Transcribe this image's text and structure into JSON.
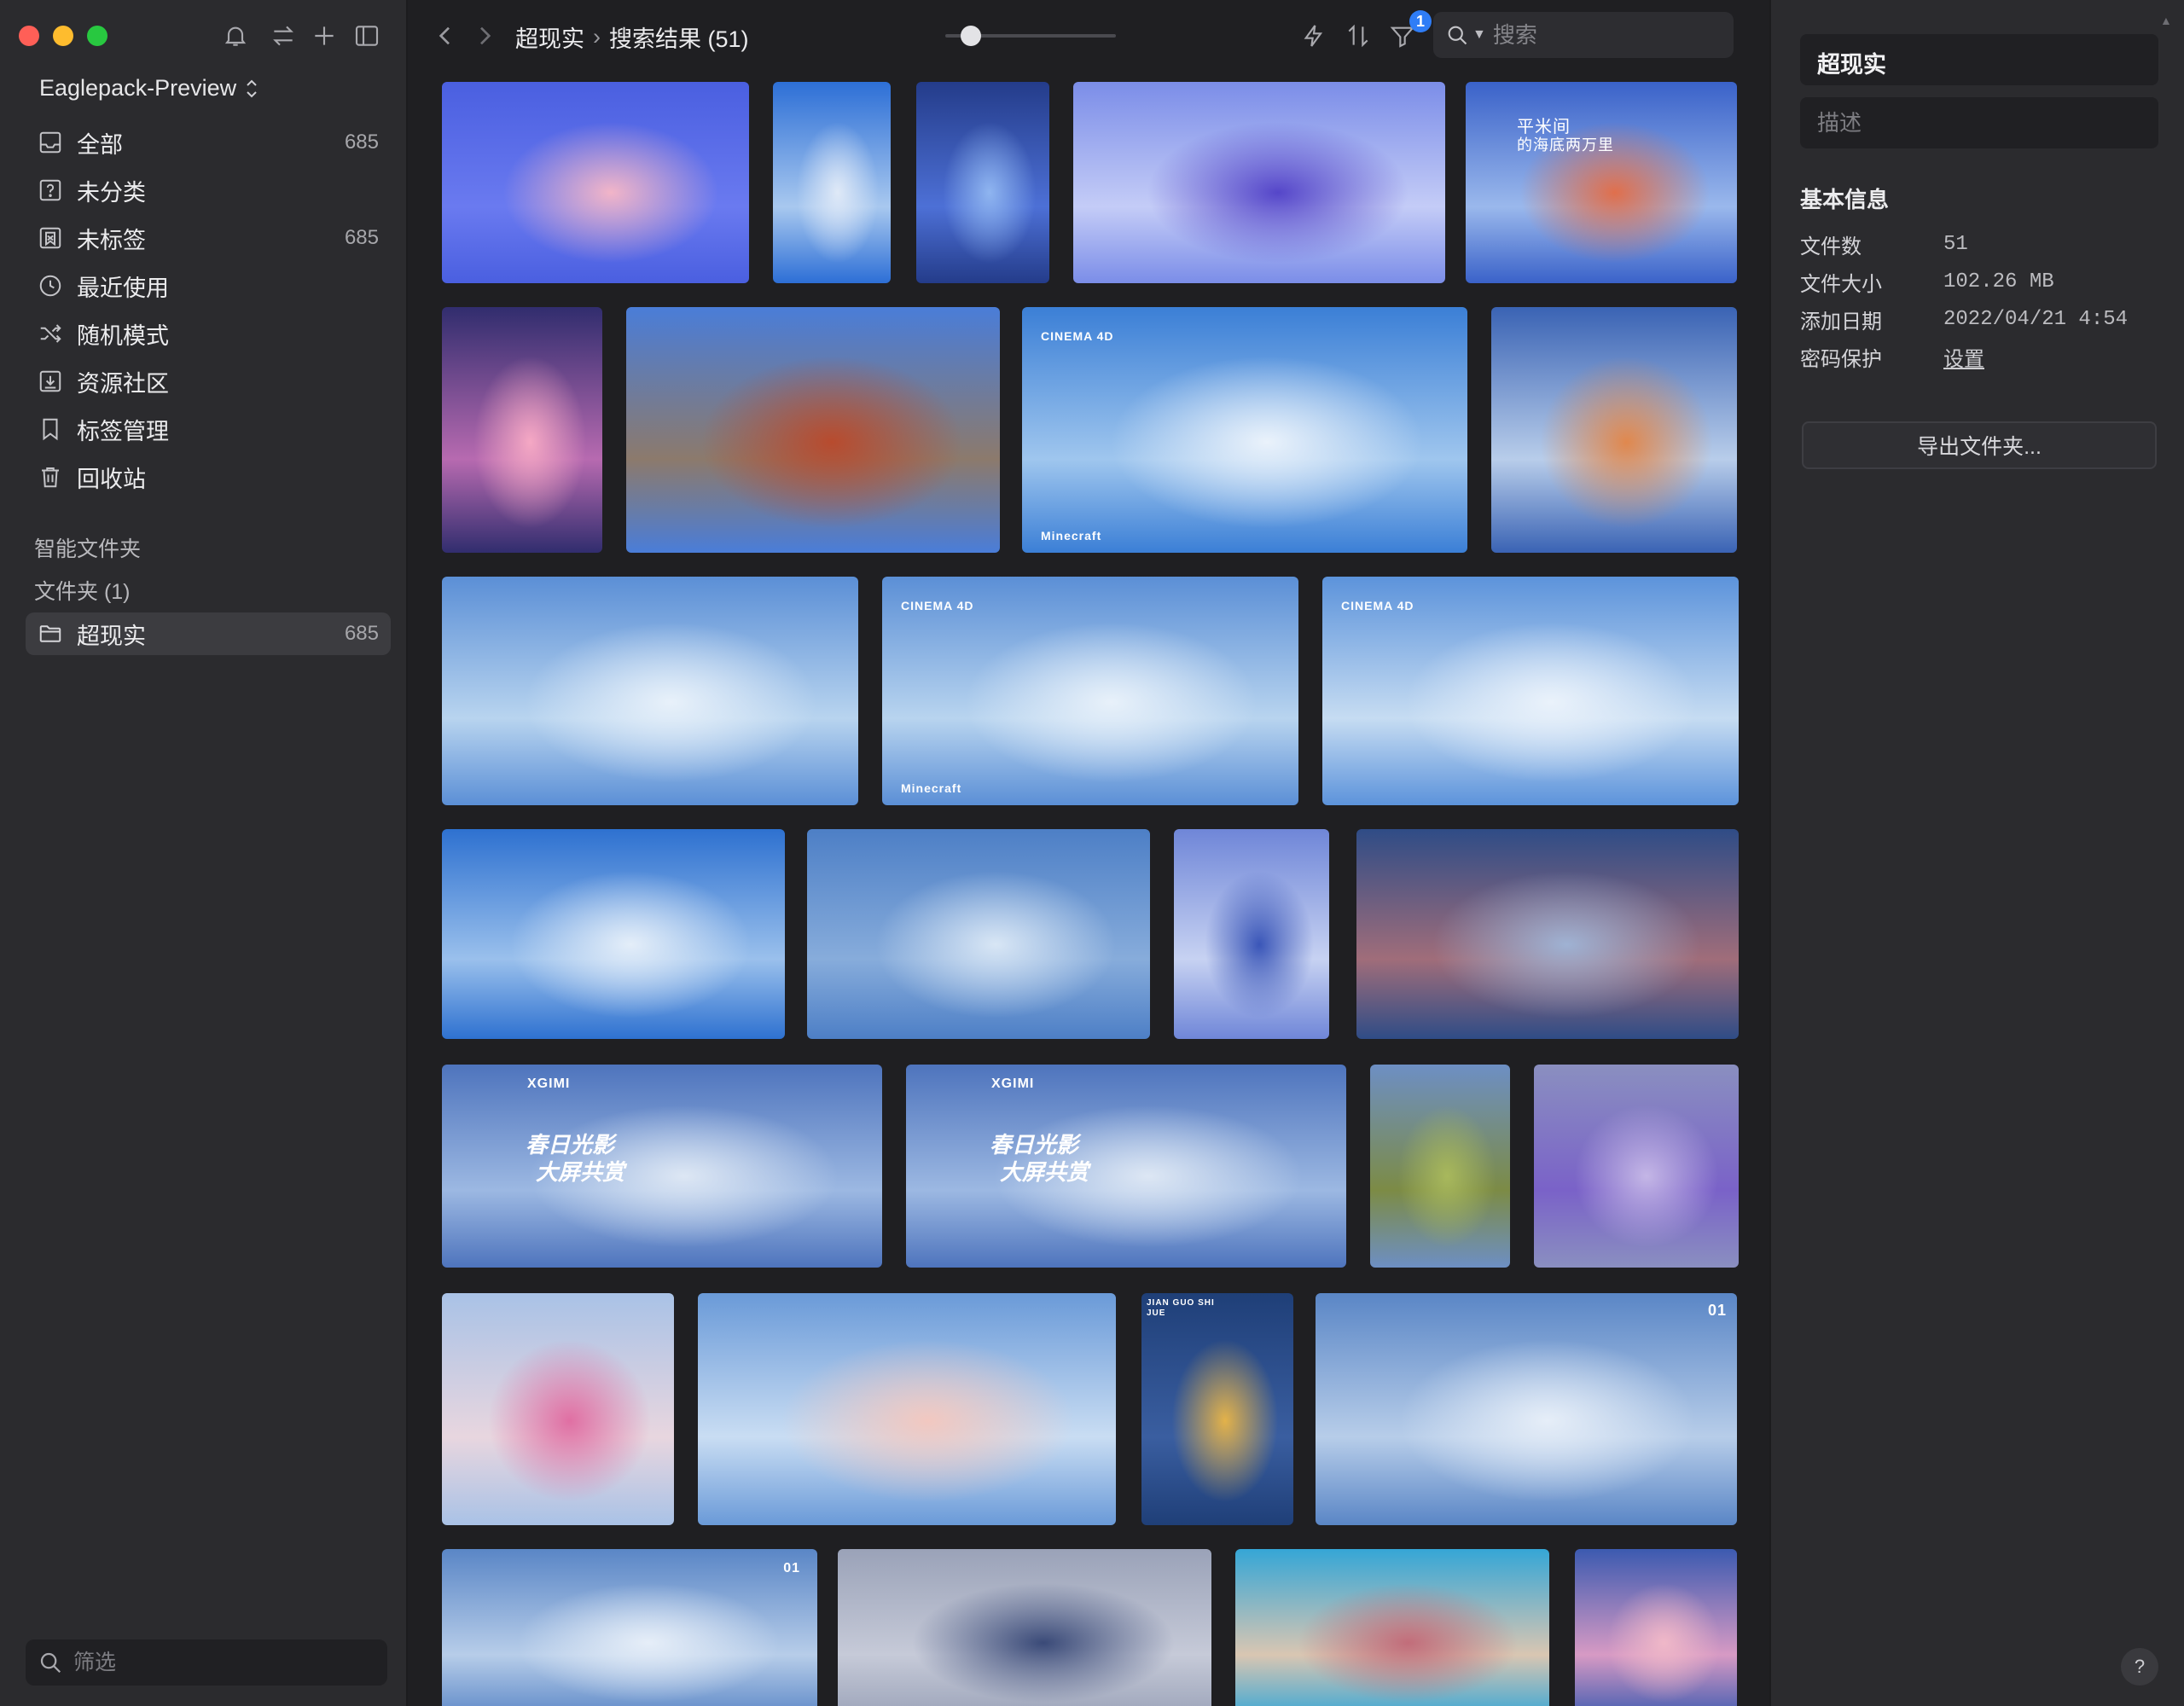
{
  "sidebar": {
    "library_name": "Eaglepack-Preview",
    "nav": [
      {
        "label": "全部",
        "count": "685",
        "icon": "inbox-icon"
      },
      {
        "label": "未分类",
        "count": "",
        "icon": "question-box-icon"
      },
      {
        "label": "未标签",
        "count": "685",
        "icon": "untagged-icon"
      },
      {
        "label": "最近使用",
        "count": "",
        "icon": "clock-icon"
      },
      {
        "label": "随机模式",
        "count": "",
        "icon": "shuffle-icon"
      },
      {
        "label": "资源社区",
        "count": "",
        "icon": "download-box-icon"
      },
      {
        "label": "标签管理",
        "count": "",
        "icon": "bookmark-icon"
      },
      {
        "label": "回收站",
        "count": "",
        "icon": "trash-icon"
      }
    ],
    "smart_folders_label": "智能文件夹",
    "folders_label": "文件夹 (1)",
    "folder": {
      "label": "超现实",
      "count": "685"
    },
    "filter_placeholder": "筛选"
  },
  "toolbar": {
    "breadcrumb_folder": "超现实",
    "breadcrumb_separator": "›",
    "breadcrumb_result": "搜索结果 (51)",
    "zoom_level": 0.15,
    "filter_badge": "1",
    "search_placeholder": "搜索"
  },
  "grid": {
    "thumbs": [
      {
        "palette": [
          "#4a5fe0",
          "#6a7af0",
          "#f2b5c8"
        ]
      },
      {
        "palette": [
          "#2d6fd6",
          "#a8c8ef",
          "#dfe9f7"
        ]
      },
      {
        "palette": [
          "#243c8a",
          "#4d70d6",
          "#8fb5f0"
        ]
      },
      {
        "palette": [
          "#7b8de8",
          "#c4ccf7",
          "#5546c9"
        ]
      },
      {
        "palette": [
          "#3a62c9",
          "#9ab8ec",
          "#e06f4c"
        ]
      },
      {
        "palette": [
          "#312d6e",
          "#b76ab0",
          "#f5a8c4"
        ]
      },
      {
        "palette": [
          "#4a7dd8",
          "#8c7a6c",
          "#b84b2e"
        ]
      },
      {
        "palette": [
          "#3b7fd6",
          "#9fc6ee",
          "#eaf2fb"
        ]
      },
      {
        "palette": [
          "#3a63b4",
          "#b8cdea",
          "#e0884e"
        ]
      },
      {
        "palette": [
          "#5b8fd6",
          "#b8d4ef",
          "#e8f1fa"
        ]
      },
      {
        "palette": [
          "#5b8fd6",
          "#b8d4ef",
          "#e8f1fa"
        ]
      },
      {
        "palette": [
          "#5c93db",
          "#c6dcf2",
          "#eaf2fb"
        ]
      },
      {
        "palette": [
          "#2e71d0",
          "#9ac0ec",
          "#e4eef9"
        ]
      },
      {
        "palette": [
          "#4d7fc6",
          "#87acdb",
          "#d8e6f5"
        ]
      },
      {
        "palette": [
          "#6f86d8",
          "#c7d2f2",
          "#3a56b8"
        ]
      },
      {
        "palette": [
          "#2f4c86",
          "#a06d7a",
          "#9fb2d3"
        ]
      },
      {
        "palette": [
          "#4e74bd",
          "#9cb8e2",
          "#dde7f4"
        ]
      },
      {
        "palette": [
          "#4e74bd",
          "#9cb8e2",
          "#dde7f4"
        ]
      },
      {
        "palette": [
          "#6d8fc4",
          "#7c8b45",
          "#a8b85c"
        ]
      },
      {
        "palette": [
          "#8a8fc0",
          "#7a62c8",
          "#c4b6e6"
        ]
      },
      {
        "palette": [
          "#a9c2e6",
          "#e8d6df",
          "#e06fa3"
        ]
      },
      {
        "palette": [
          "#6a9ad8",
          "#c9ddf3",
          "#f2c8c0"
        ]
      },
      {
        "palette": [
          "#1f3f78",
          "#3a5ea0",
          "#e3b24a"
        ]
      },
      {
        "palette": [
          "#5a86c6",
          "#b7cde9",
          "#e6eef8"
        ]
      },
      {
        "palette": [
          "#5a86c6",
          "#b7cde9",
          "#e6eef8"
        ]
      },
      {
        "palette": [
          "#9aa2b8",
          "#c6cad8",
          "#3a4a78"
        ]
      },
      {
        "palette": [
          "#35a6d6",
          "#d9c6b2",
          "#c26d7a"
        ]
      },
      {
        "palette": [
          "#3c5ab0",
          "#d79ac4",
          "#f0b8c8"
        ]
      }
    ],
    "captions": {
      "cinema4d": "CINEMA 4D",
      "minecraft": "Minecraft",
      "xgimi": "XGIMI",
      "spring_line1": "春日光影",
      "spring_line2": "大屏共赏",
      "xiaomi_line1": "平米间",
      "xiaomi_line2": "的海底两万里",
      "jianguo": "JIAN GUO SHI JUE",
      "num01": "01"
    }
  },
  "inspector": {
    "title": "超现实",
    "desc_placeholder": "描述",
    "section_title": "基本信息",
    "rows": [
      {
        "key": "文件数",
        "value": "51"
      },
      {
        "key": "文件大小",
        "value": "102.26 MB"
      },
      {
        "key": "添加日期",
        "value": "2022/04/21 4:54"
      },
      {
        "key": "密码保护",
        "value": "设置"
      }
    ],
    "export_button": "导出文件夹...",
    "help": "?"
  }
}
